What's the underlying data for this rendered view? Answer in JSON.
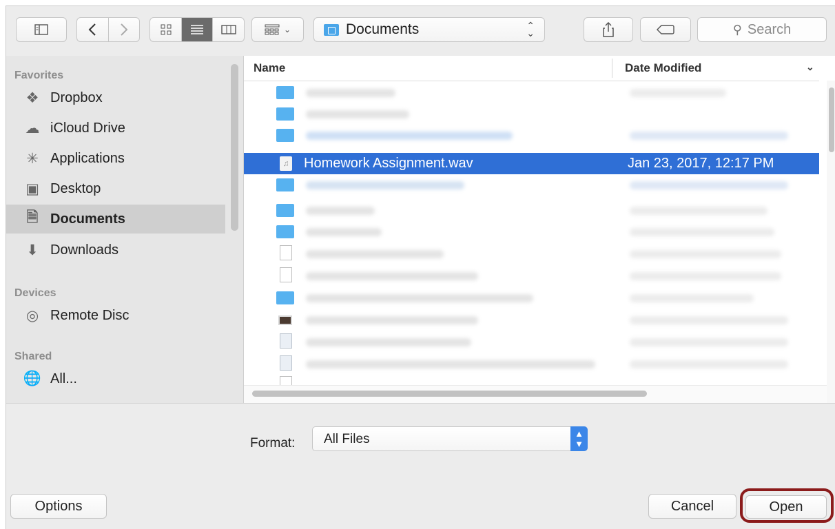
{
  "toolbar": {
    "sidebar_toggle_icon": "sidebar-icon",
    "back_icon": "chevron-left-icon",
    "forward_icon": "chevron-right-icon",
    "view_icons": [
      "icon-view-icon",
      "list-view-icon",
      "column-view-icon"
    ],
    "arrange_icon": "grid-arrange-icon",
    "location": "Documents",
    "share_icon": "share-icon",
    "tag_icon": "tag-icon",
    "search_placeholder": "Search"
  },
  "sidebar": {
    "sections": [
      {
        "heading": "Favorites",
        "items": [
          {
            "label": "Dropbox",
            "icon": "dropbox-icon"
          },
          {
            "label": "iCloud Drive",
            "icon": "cloud-icon"
          },
          {
            "label": "Applications",
            "icon": "applications-icon"
          },
          {
            "label": "Desktop",
            "icon": "desktop-icon"
          },
          {
            "label": "Documents",
            "icon": "documents-icon",
            "selected": true
          },
          {
            "label": "Downloads",
            "icon": "downloads-icon"
          }
        ]
      },
      {
        "heading": "Devices",
        "items": [
          {
            "label": "Remote Disc",
            "icon": "disc-icon"
          }
        ]
      },
      {
        "heading": "Shared",
        "items": [
          {
            "label": "All...",
            "icon": "network-icon"
          }
        ]
      }
    ]
  },
  "file_list": {
    "columns": [
      "Name",
      "Date Modified"
    ],
    "selected_file": {
      "name": "Homework Assignment.wav",
      "date": "Jan 23, 2017, 12:17 PM",
      "icon": "audio-file-icon"
    },
    "rows_icons": [
      "folder",
      "folder",
      "folder",
      "selected",
      "folder",
      "folder",
      "folder",
      "document",
      "document",
      "folder",
      "image",
      "misc",
      "misc",
      "document"
    ]
  },
  "format": {
    "label": "Format:",
    "value": "All Files"
  },
  "buttons": {
    "options": "Options",
    "cancel": "Cancel",
    "open": "Open"
  },
  "colors": {
    "selection": "#2f6fd6",
    "highlight_ring": "#8b1b1b",
    "select_stepper": "#3b86e8"
  }
}
